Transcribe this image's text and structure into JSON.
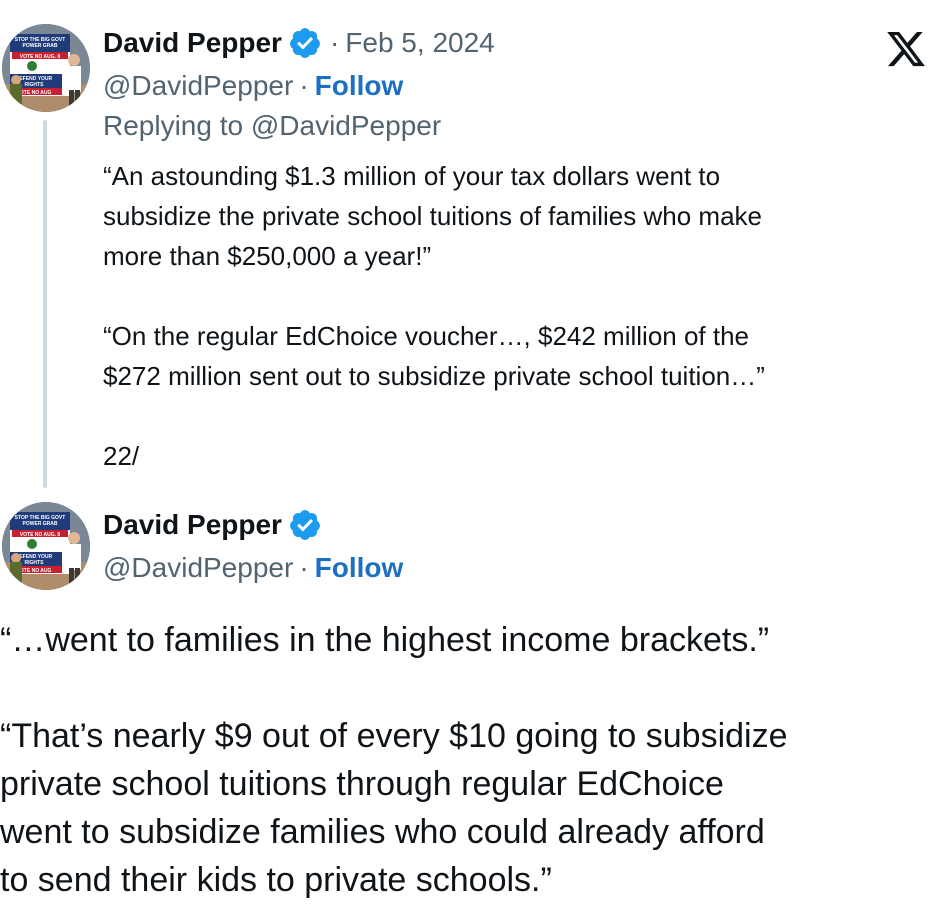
{
  "reply_tweet": {
    "display_name": "David Pepper",
    "date": "Feb 5, 2024",
    "handle": "@DavidPepper",
    "follow_label": "Follow",
    "replying_to": "Replying to @DavidPepper",
    "paragraph1_line1": "“An astounding $1.3 million of your tax dollars went to",
    "paragraph1_line2": "subsidize the private school tuitions of families who make",
    "paragraph1_line3": "more than $250,000 a year!”",
    "paragraph2_line1": "“On the regular EdChoice voucher…, $242 million of the",
    "paragraph2_line2": "$272 million sent out to subsidize private school tuition…”",
    "paragraph3": "22/"
  },
  "main_tweet": {
    "display_name": "David Pepper",
    "handle": "@DavidPepper",
    "follow_label": "Follow",
    "paragraph1": "“…went to families in the highest income brackets.”",
    "paragraph2_line1": "“That’s nearly $9 out of every $10 going to subsidize",
    "paragraph2_line2": "private school tuitions through regular EdChoice",
    "paragraph2_line3": "went to subsidize families who could already afford",
    "paragraph2_line4": "to send their kids to private schools.”"
  },
  "avatar_sign_text": {
    "line1": "STOP THE BIG GOVT",
    "line2": "POWER GRAB",
    "line3": "VOTE NO AUG. 8",
    "line4": "DEFEND YOUR",
    "line5": "RIGHTS",
    "line6": "VOTE NO AUG"
  },
  "icons": {
    "brand": "x-logo-icon",
    "verified": "verified-badge-icon",
    "avatar": "avatar-photo"
  },
  "colors": {
    "text": "#0f1419",
    "secondary": "#536471",
    "follow": "#1d6fc4",
    "verified": "#1d9bf0",
    "thread_line": "#cfd9de"
  }
}
